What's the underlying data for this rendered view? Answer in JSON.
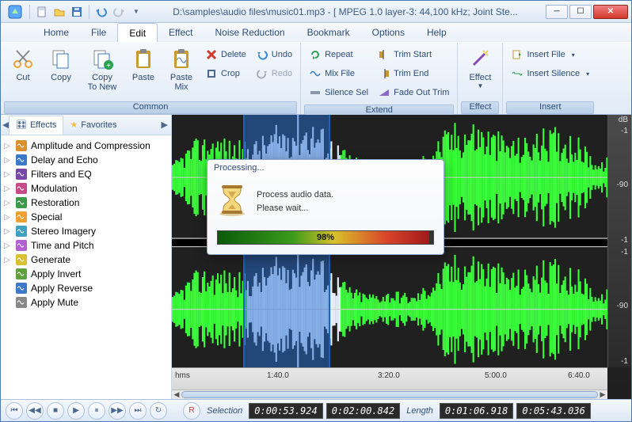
{
  "title": "D:\\samples\\audio files\\music01.mp3 - [ MPEG 1.0 layer-3: 44,100 kHz; Joint Ste...",
  "menu": [
    "Home",
    "File",
    "Edit",
    "Effect",
    "Noise Reduction",
    "Bookmark",
    "Options",
    "Help"
  ],
  "menu_active": "Edit",
  "ribbon": {
    "common": {
      "label": "Common",
      "cut": "Cut",
      "copy": "Copy",
      "copy_new": "Copy\nTo New",
      "paste": "Paste",
      "paste_mix": "Paste\nMix",
      "delete": "Delete",
      "crop": "Crop",
      "undo": "Undo",
      "redo": "Redo"
    },
    "extend": {
      "label": "Extend",
      "repeat": "Repeat",
      "mixfile": "Mix File",
      "silencesel": "Silence Sel",
      "trimstart": "Trim Start",
      "trimend": "Trim End",
      "fadeouttrim": "Fade Out Trim"
    },
    "effect": {
      "label": "Effect",
      "effect": "Effect"
    },
    "insert": {
      "label": "Insert",
      "insertfile": "Insert File",
      "insertsilence": "Insert Silence"
    }
  },
  "sidebar": {
    "tabs": {
      "effects": "Effects",
      "favorites": "Favorites"
    },
    "items": [
      {
        "label": "Amplitude and Compression",
        "expandable": true
      },
      {
        "label": "Delay and Echo",
        "expandable": true
      },
      {
        "label": "Filters and EQ",
        "expandable": true
      },
      {
        "label": "Modulation",
        "expandable": true
      },
      {
        "label": "Restoration",
        "expandable": true
      },
      {
        "label": "Special",
        "expandable": true
      },
      {
        "label": "Stereo Imagery",
        "expandable": true
      },
      {
        "label": "Time and Pitch",
        "expandable": true
      },
      {
        "label": "Generate",
        "expandable": true
      },
      {
        "label": "Apply Invert",
        "expandable": false
      },
      {
        "label": "Apply Reverse",
        "expandable": false
      },
      {
        "label": "Apply Mute",
        "expandable": false
      }
    ]
  },
  "db_labels": {
    "hdr": "dB",
    "l1": "-1",
    "l2": "-90",
    "l3": "-1",
    "l4": "-1",
    "l5": "-90",
    "l6": "-1"
  },
  "timeline": {
    "unit": "hms",
    "t1": "1:40.0",
    "t2": "3:20.0",
    "t3": "5:00.0",
    "t4": "6:40.0"
  },
  "transport": {
    "selection_label": "Selection",
    "length_label": "Length",
    "sel_start": "0:00:53.924",
    "sel_end": "0:02:00.842",
    "len_a": "0:01:06.918",
    "len_b": "0:05:43.036"
  },
  "modal": {
    "title": "Processing...",
    "line1": "Process audio data.",
    "line2": "Please wait...",
    "pct": "98%",
    "pct_width": "98%"
  },
  "icon_colors": {
    "cut": "#f0a030",
    "copy": "#3a78c8",
    "copy_new": "#2aa050",
    "paste": "#c89a30",
    "delete": "#d23a2a",
    "crop": "#4a6890",
    "undo": "#3a8ad2",
    "redo": "#3a8ad2",
    "repeat": "#2aa050",
    "mix": "#3a78c8",
    "silence": "#8898a8",
    "trim": "#c89a30",
    "fade": "#8868c8",
    "effect": "#8848b8",
    "file": "#c89a30",
    "wave": "#2aa050"
  }
}
